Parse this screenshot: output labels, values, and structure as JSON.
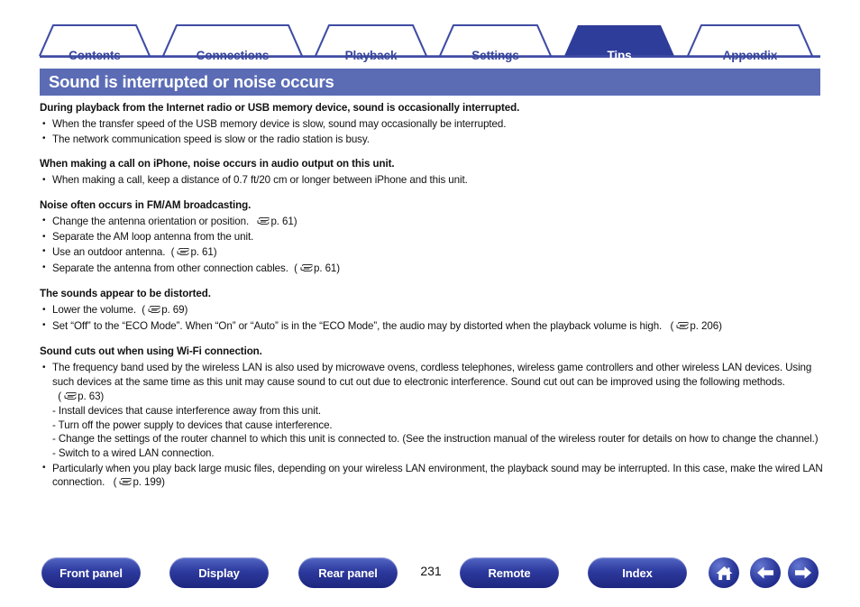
{
  "tabs": [
    {
      "label": "Contents",
      "active": false
    },
    {
      "label": "Connections",
      "active": false
    },
    {
      "label": "Playback",
      "active": false
    },
    {
      "label": "Settings",
      "active": false
    },
    {
      "label": "Tips",
      "active": true
    },
    {
      "label": "Appendix",
      "active": false
    }
  ],
  "page": {
    "title": "Sound is interrupted or noise occurs",
    "number": "231",
    "title_bar_color": "#5b6cb5",
    "accent_color": "#37459b"
  },
  "sections": [
    {
      "heading": "During playback from the Internet radio or USB memory device, sound is occasionally interrupted.",
      "bullets": [
        {
          "text": "When the transfer speed of the USB memory device is slow, sound may occasionally be interrupted.",
          "ref": ""
        },
        {
          "text": "The network communication speed is slow or the radio station is busy.",
          "ref": ""
        }
      ]
    },
    {
      "heading": "When making a call on iPhone, noise occurs in audio output on this unit.",
      "bullets": [
        {
          "text": "When making a call, keep a distance of 0.7 ft/20 cm or longer between iPhone and this unit.",
          "ref": ""
        }
      ]
    },
    {
      "heading": "Noise often occurs in FM/AM broadcasting.",
      "bullets": [
        {
          "text": "Change the antenna orientation or position.",
          "ref": "p. 61"
        },
        {
          "text": "Separate the AM loop antenna from the unit.",
          "ref": ""
        },
        {
          "text": "Use an outdoor antenna.",
          "ref": "p. 61"
        },
        {
          "text": "Separate the antenna from other connection cables.",
          "ref": "p. 61"
        }
      ]
    },
    {
      "heading": "The sounds appear to be distorted.",
      "bullets": [
        {
          "text": "Lower the volume.",
          "ref": "p. 69"
        },
        {
          "text": "Set “Off” to the “ECO Mode”. When “On” or “Auto” is in the “ECO Mode”, the audio may by distorted when the playback volume is high.",
          "ref": "p. 206"
        }
      ]
    },
    {
      "heading": "Sound cuts out when using Wi-Fi connection.",
      "bullets": [
        {
          "text": "The frequency band used by the wireless LAN is also used by microwave ovens, cordless telephones, wireless game controllers and other wireless LAN devices. Using such devices at the same time as this unit may cause sound to cut out due to electronic interference. Sound cut out can be improved using the following methods.",
          "ref": "p. 63",
          "sublines": [
            "- Install devices that cause interference away from this unit.",
            "- Turn off the power supply to devices that cause interference.",
            "- Change the settings of the router channel to which this unit is connected to. (See the instruction manual of the wireless router for details on how to change the channel.)",
            "- Switch to a wired LAN connection."
          ]
        },
        {
          "text": "Particularly when you play back large music files, depending on your wireless LAN environment, the playback sound may be interrupted. In this case, make the wired LAN connection.",
          "ref": "p. 199"
        }
      ]
    }
  ],
  "footer": {
    "buttons": [
      {
        "label": "Front panel"
      },
      {
        "label": "Display"
      },
      {
        "label": "Rear panel"
      },
      {
        "label": "Remote"
      },
      {
        "label": "Index"
      }
    ],
    "icons": [
      {
        "name": "home-icon"
      },
      {
        "name": "arrow-left-icon"
      },
      {
        "name": "arrow-right-icon"
      }
    ]
  }
}
